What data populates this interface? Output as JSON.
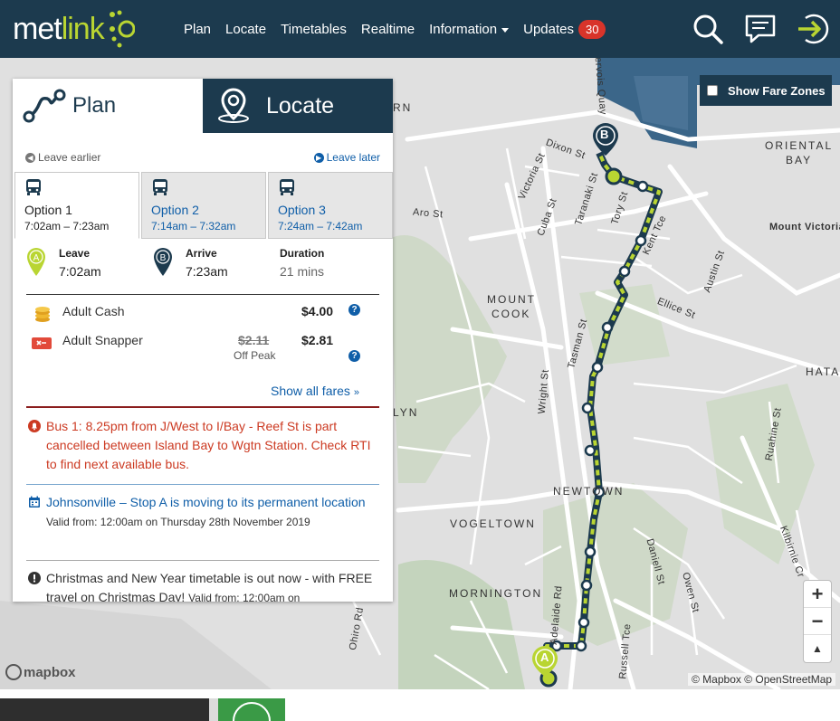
{
  "nav": {
    "logo_prefix": "met",
    "logo_suffix": "link",
    "links": [
      "Plan",
      "Locate",
      "Timetables",
      "Realtime",
      "Information",
      "Updates"
    ],
    "updates_count": "30",
    "icons": [
      "search-icon",
      "message-icon",
      "login-icon"
    ]
  },
  "tabs": {
    "plan": "Plan",
    "locate": "Locate"
  },
  "leave": {
    "earlier": "Leave earlier",
    "later": "Leave later"
  },
  "options": [
    {
      "name": "Option 1",
      "time": "7:02am – 7:23am"
    },
    {
      "name": "Option 2",
      "time": "7:14am – 7:32am"
    },
    {
      "name": "Option 3",
      "time": "7:24am – 7:42am"
    }
  ],
  "trip": {
    "leave_label": "Leave",
    "leave_time": "7:02am",
    "leave_pin": "A",
    "arrive_label": "Arrive",
    "arrive_time": "7:23am",
    "arrive_pin": "B",
    "duration_label": "Duration",
    "duration_value": "21 mins"
  },
  "fares": {
    "cash_name": "Adult Cash",
    "cash_price": "$4.00",
    "snapper_name": "Adult Snapper",
    "snapper_old": "$2.11",
    "snapper_old_sub": "Off Peak",
    "snapper_price": "$2.81",
    "show_all": "Show all fares"
  },
  "alerts": {
    "red": "Bus 1: 8.25pm from J/West to I/Bay - Reef St is part cancelled between Island Bay to Wgtn Station. Check RTI to find next available bus.",
    "blue_title": "Johnsonville – Stop A is moving to its permanent location",
    "blue_valid": "Valid from: 12:00am on Thursday 28th November 2019",
    "grey_title": "Christmas and New Year timetable is out now - with FREE travel on Christmas Day!",
    "grey_valid": "Valid from: 12:00am on"
  },
  "map": {
    "show_fare_zones": "Show Fare Zones",
    "attribution": "© Mapbox © OpenStreetMap",
    "mapbox": "mapbox",
    "zoom_in": "+",
    "zoom_out": "−",
    "compass": "▲",
    "pin_a": "A",
    "pin_b": "B",
    "labels": {
      "oriental_bay": [
        "ORIENTAL",
        "BAY"
      ],
      "mount_victoria": "Mount Victoria",
      "mount_cook": [
        "MOUNT",
        "COOK"
      ],
      "newtown": "NEWTOWN",
      "vogeltown": "VOGELTOWN",
      "mornington": "MORNINGTON",
      "hata": "HATA",
      "lyn": "LYN",
      "rn": "RN",
      "streets": [
        "Dixon St",
        "Victoria St",
        "Cuba St",
        "Taranaki St",
        "Tory St",
        "Kent Tce",
        "Aro St",
        "Austin St",
        "Ellice St",
        "Tasman St",
        "Wright St",
        "Adelaide Rd",
        "Daniell St",
        "Owen St",
        "Ruahine St",
        "Kilbirnie Cr",
        "Russell Tce",
        "Ohiro Rd",
        "Jervois Quay"
      ]
    }
  }
}
